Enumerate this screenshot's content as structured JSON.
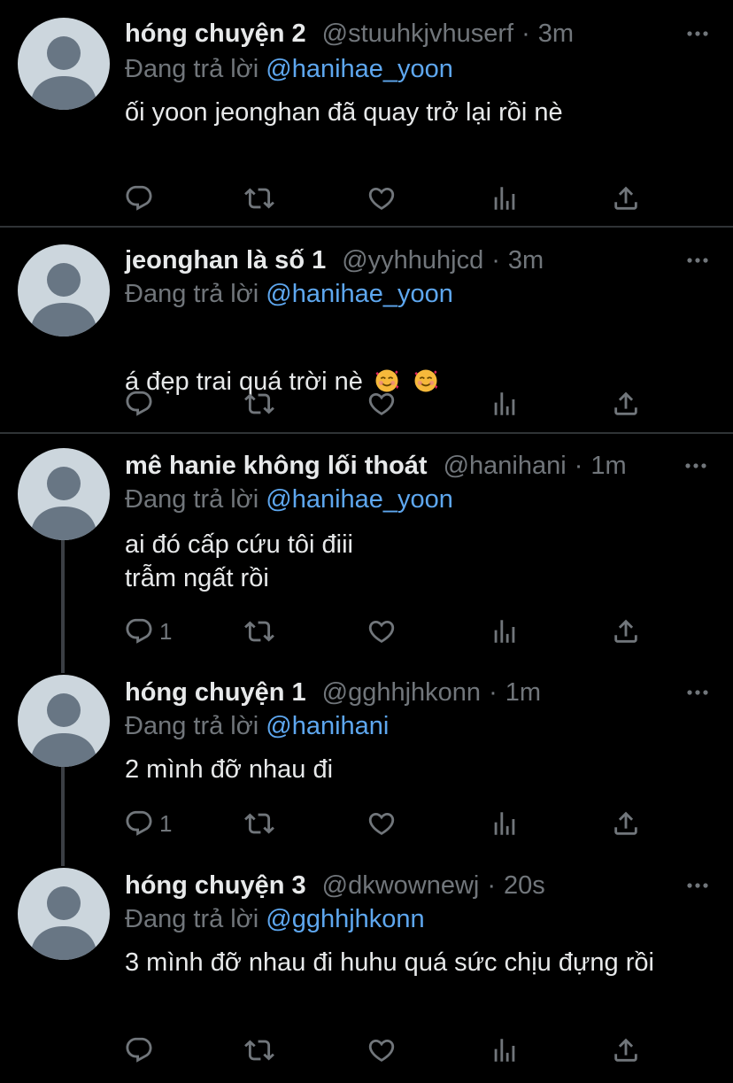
{
  "colors": {
    "background": "#000000",
    "text": "#e7e9ea",
    "muted": "#71767b",
    "mention": "#5ea7ef",
    "avatar": "#ccd6dd",
    "divider": "#2f3336"
  },
  "tweets": [
    {
      "name": "hóng chuyện 2",
      "handle": "@stuuhkjvhuserf",
      "time": "3m",
      "replying_prefix": "Đang trả lời",
      "replying_to": "@hanihae_yoon",
      "text": "ối yoon jeonghan đã quay trở lại rồi nè",
      "reply_count": ""
    },
    {
      "name": "jeonghan là số 1",
      "handle": "@yyhhuhjcd",
      "time": "3m",
      "replying_prefix": "Đang trả lời",
      "replying_to": "@hanihae_yoon",
      "text": "á đẹp trai quá trời nè",
      "emojis": [
        "smiling-face-with-hearts-icon",
        "smiling-face-with-hearts-icon"
      ],
      "reply_count": ""
    },
    {
      "name": "mê hanie không lối thoát",
      "handle": "@hanihani",
      "time": "1m",
      "replying_prefix": "Đang trả lời",
      "replying_to": "@hanihae_yoon",
      "text": "ai đó cấp cứu tôi điii\ntrẫm ngất rồi",
      "reply_count": "1"
    },
    {
      "name": "hóng chuyện 1",
      "handle": "@gghhjhkonn",
      "time": "1m",
      "replying_prefix": "Đang trả lời",
      "replying_to": "@hanihani",
      "text": "2 mình đỡ nhau đi",
      "reply_count": "1"
    },
    {
      "name": "hóng chuyện 3",
      "handle": "@dkwownewj",
      "time": "20s",
      "replying_prefix": "Đang trả lời",
      "replying_to": "@gghhjhkonn",
      "text": "3 mình đỡ nhau đi huhu quá sức chịu đựng rồi",
      "reply_count": ""
    }
  ],
  "dot_separator": "·",
  "icons": {
    "reply": "reply-icon",
    "retweet": "retweet-icon",
    "like": "heart-icon",
    "analytics": "analytics-icon",
    "share": "share-icon",
    "more": "more-icon",
    "avatar": "default-avatar-icon"
  }
}
